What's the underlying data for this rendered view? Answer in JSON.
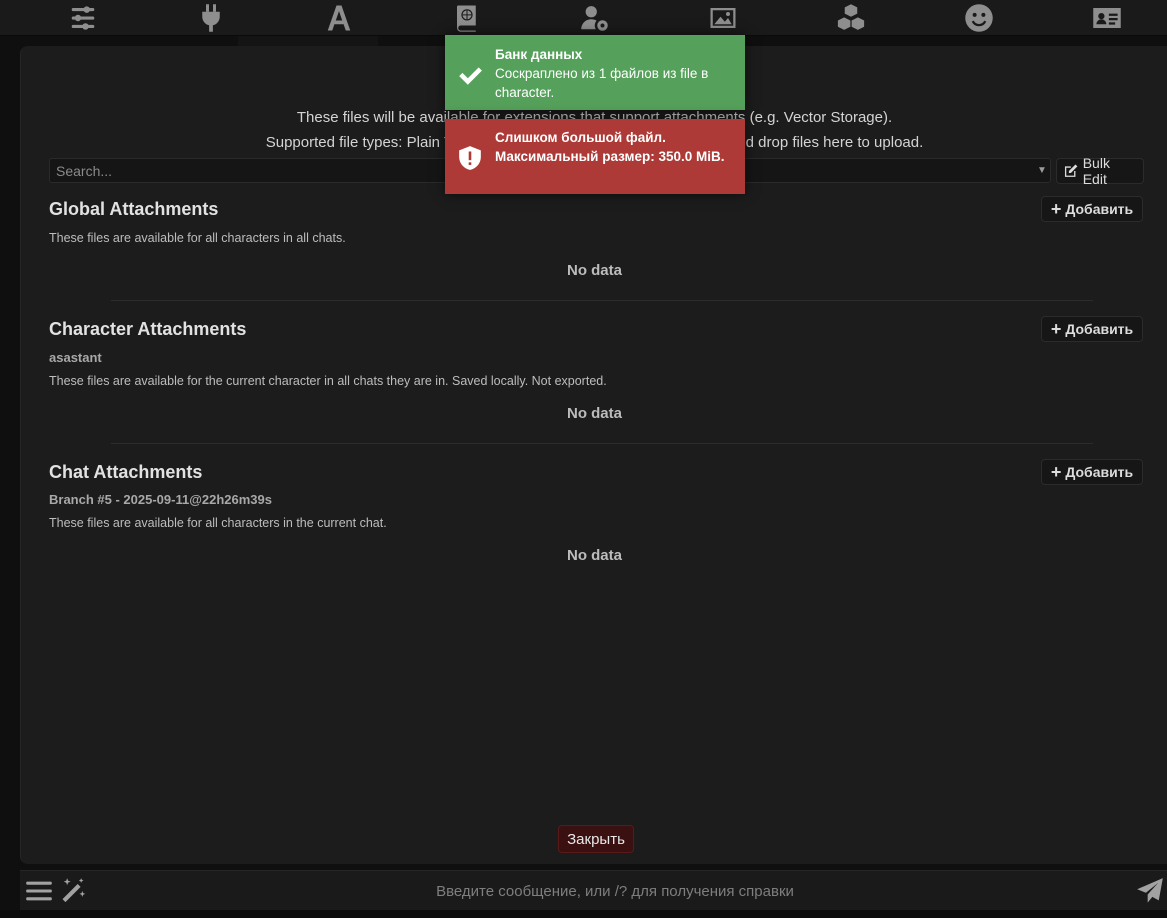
{
  "nav": {
    "icons": [
      {
        "name": "sliders-icon"
      },
      {
        "name": "plug-icon"
      },
      {
        "name": "font-icon"
      },
      {
        "name": "book-globe-icon"
      },
      {
        "name": "user-gear-icon"
      },
      {
        "name": "image-icon"
      },
      {
        "name": "cubes-icon"
      },
      {
        "name": "smile-icon"
      },
      {
        "name": "id-card-icon"
      }
    ]
  },
  "intro": {
    "line1": "These files will be available for extensions that support attachments (e.g. Vector Storage).",
    "line2": "Supported file types: Plain Text, PDF, Markdown, HTML, EPUB. Drag and drop files here to upload."
  },
  "search": {
    "placeholder": "Search..."
  },
  "toolbar": {
    "bulk_edit_label": "Bulk Edit"
  },
  "sections": {
    "global": {
      "title": "Global Attachments",
      "description": "These files are available for all characters in all chats.",
      "empty_text": "No data",
      "add_label": "Добавить"
    },
    "character": {
      "title": "Character Attachments",
      "subtitle": "asastant",
      "description": "These files are available for the current character in all chats they are in. Saved locally. Not exported.",
      "empty_text": "No data",
      "add_label": "Добавить"
    },
    "chat": {
      "title": "Chat Attachments",
      "subtitle": "Branch #5 - 2025-09-11@22h26m39s",
      "description": "These files are available for all characters in the current chat.",
      "empty_text": "No data",
      "add_label": "Добавить"
    }
  },
  "footer": {
    "close_label": "Закрыть"
  },
  "toasts": {
    "success": {
      "title": "Банк данных",
      "message": "Соскраплено из 1 файлов из file в character.",
      "color": "#55a05a"
    },
    "error": {
      "message": "Слишком большой файл. Максимальный размер: 350.0 MiB.",
      "color": "#ad3a36"
    }
  },
  "chat_input": {
    "placeholder": "Введите сообщение, или /? для получения справки"
  }
}
